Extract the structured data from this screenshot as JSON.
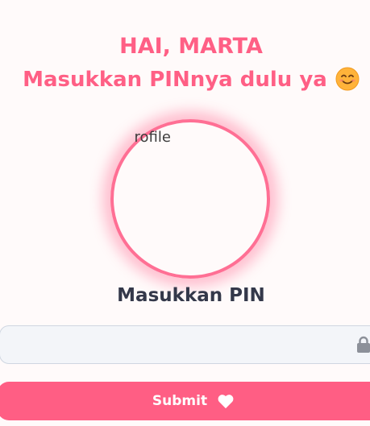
{
  "greeting": {
    "line1": "HAI, MARTA",
    "line2": "Masukkan PINnya dulu ya",
    "emoji_icon": "smiling-face-icon"
  },
  "profile": {
    "image_alt": "Profile"
  },
  "pin": {
    "heading": "Masukkan PIN",
    "value": "",
    "placeholder": "",
    "lock_icon": "lock-icon"
  },
  "submit": {
    "label": "Submit",
    "icon": "heart-icon"
  },
  "colors": {
    "accent": "#ff5e84",
    "heading_text": "#34384a",
    "field_bg": "#f3f5f9",
    "field_border": "#cfd6e1",
    "background": "#fffafa"
  }
}
